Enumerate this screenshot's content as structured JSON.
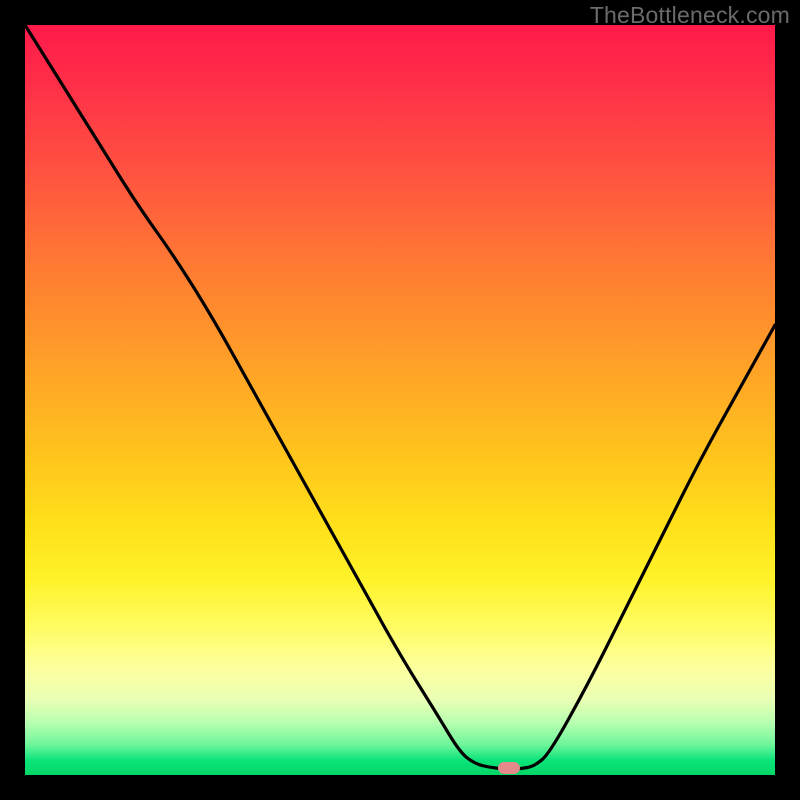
{
  "watermark": "TheBottleneck.com",
  "marker": {
    "x_pct": 64.5,
    "y_bottom_pct": 1.0
  },
  "chart_data": {
    "type": "line",
    "title": "",
    "xlabel": "",
    "ylabel": "",
    "xlim": [
      0,
      100
    ],
    "ylim": [
      0,
      100
    ],
    "series": [
      {
        "name": "bottleneck-curve",
        "x": [
          0,
          5,
          10,
          15,
          20,
          25,
          30,
          35,
          40,
          45,
          50,
          55,
          58,
          60,
          62,
          64,
          66,
          68,
          70,
          75,
          80,
          85,
          90,
          95,
          100
        ],
        "y": [
          100,
          92,
          84,
          76,
          69,
          61,
          52,
          43,
          34,
          25,
          16,
          8,
          3,
          1.5,
          1.0,
          0.8,
          0.8,
          1.2,
          3,
          12,
          22,
          32,
          42,
          51,
          60
        ]
      }
    ],
    "annotations": [
      {
        "type": "marker",
        "x": 64.5,
        "y": 1.0,
        "label": "optimal-point"
      }
    ],
    "background": {
      "type": "vertical-gradient",
      "stops": [
        {
          "pct": 0,
          "color": "#ff1a4a"
        },
        {
          "pct": 32,
          "color": "#ff7a33"
        },
        {
          "pct": 67,
          "color": "#ffe11a"
        },
        {
          "pct": 90,
          "color": "#e8ffb4"
        },
        {
          "pct": 100,
          "color": "#00d766"
        }
      ]
    }
  },
  "colors": {
    "curve": "#000000",
    "marker": "#e48a8a",
    "frame": "#000000"
  }
}
